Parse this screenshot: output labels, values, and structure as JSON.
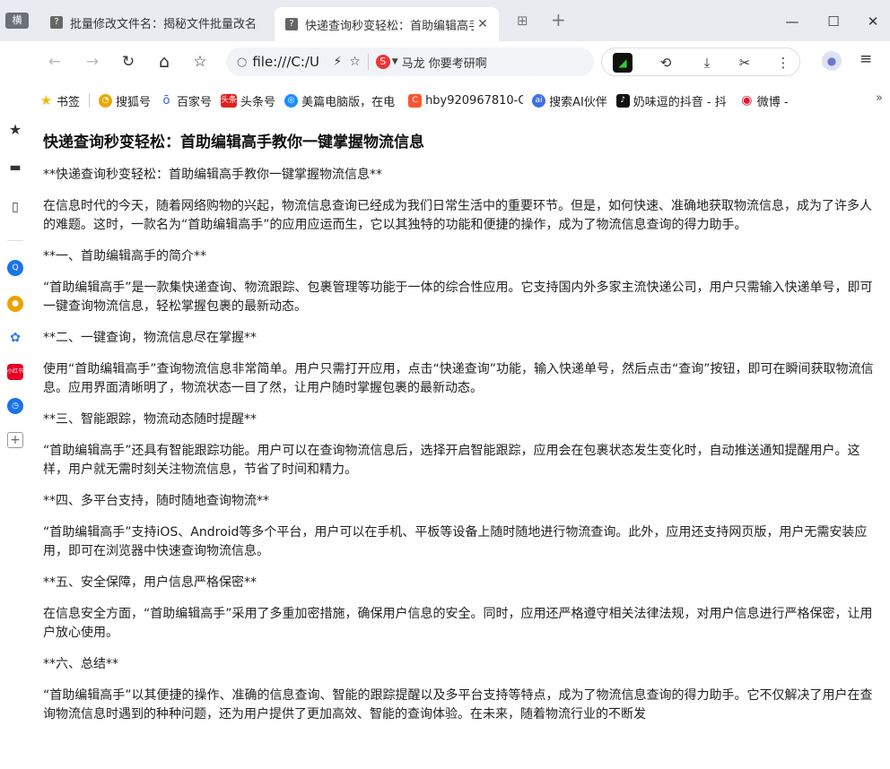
{
  "tabstrip": {
    "mode_label": "横",
    "tabs": [
      {
        "title": "批量修改文件名：揭秘文件批量改名",
        "active": false
      },
      {
        "title": "快递查询秒变轻松：首助编辑高手",
        "active": true
      }
    ],
    "close_glyph": "✕",
    "new_tab_glyph": "+",
    "window": {
      "minimize": "—",
      "maximize": "☐",
      "close": "✕"
    }
  },
  "toolbar": {
    "sidebar_toggle": "«",
    "back": "←",
    "forward": "→",
    "reload": "↻",
    "home": "⌂",
    "bookmark": "☆",
    "address": {
      "url": "file:///C:/U",
      "search_engine_letter": "S",
      "search_text": "马龙 你要考研啊"
    },
    "extensions": {
      "history": "⟲",
      "download": "⤓",
      "screenshot": "✂",
      "more": "⋮"
    },
    "menu": "≡"
  },
  "bookmarks": {
    "items": [
      {
        "label": "书签",
        "icon": "star-icon",
        "color": "#f5b800"
      },
      {
        "label": "搜狐号",
        "icon": "sohu-icon",
        "color": "#e8a800"
      },
      {
        "label": "百家号",
        "icon": "baijia-icon",
        "color": "#2b5ce6"
      },
      {
        "label": "头条号",
        "icon": "toutiao-icon",
        "color": "#e02020"
      },
      {
        "label": "美篇电脑版，在电",
        "icon": "meipian-icon",
        "color": "#1a8cff"
      },
      {
        "label": "hby920967810-C",
        "icon": "csdn-icon",
        "color": "#fc5531"
      },
      {
        "label": "搜索AI伙伴",
        "icon": "ai-icon",
        "color": "#3d6fe6"
      },
      {
        "label": "奶味逗的抖音 - 抖",
        "icon": "douyin-icon",
        "color": "#111111"
      },
      {
        "label": "微博 -",
        "icon": "weibo-icon",
        "color": "#e6162d"
      }
    ],
    "more": "»"
  },
  "sidebar": {
    "apps": [
      {
        "name": "favorites",
        "color": "#333333"
      },
      {
        "name": "folder",
        "color": "#333333"
      },
      {
        "name": "phone",
        "color": "#333333"
      },
      {
        "name": "search-app",
        "color": "#1a73e8"
      },
      {
        "name": "colorful-app",
        "color": "#f0a000"
      },
      {
        "name": "paw-app",
        "color": "#2e7be6"
      },
      {
        "name": "xiaohongshu-app",
        "color": "#e60023"
      },
      {
        "name": "clock-app",
        "color": "#1a73e8"
      },
      {
        "name": "add-app",
        "color": "#666666"
      }
    ]
  },
  "article": {
    "title": "快递查询秒变轻松：首助编辑高手教你一键掌握物流信息",
    "paragraphs": [
      "**快递查询秒变轻松：首助编辑高手教你一键掌握物流信息**",
      "在信息时代的今天，随着网络购物的兴起，物流信息查询已经成为我们日常生活中的重要环节。但是，如何快速、准确地获取物流信息，成为了许多人的难题。这时，一款名为“首助编辑高手”的应用应运而生，它以其独特的功能和便捷的操作，成为了物流信息查询的得力助手。",
      "**一、首助编辑高手的简介**",
      "“首助编辑高手”是一款集快递查询、物流跟踪、包裹管理等功能于一体的综合性应用。它支持国内外多家主流快递公司，用户只需输入快递单号，即可一键查询物流信息，轻松掌握包裹的最新动态。",
      "**二、一键查询，物流信息尽在掌握**",
      "使用“首助编辑高手”查询物流信息非常简单。用户只需打开应用，点击“快递查询”功能，输入快递单号，然后点击“查询”按钮，即可在瞬间获取物流信息。应用界面清晰明了，物流状态一目了然，让用户随时掌握包裹的最新动态。",
      "**三、智能跟踪，物流动态随时提醒**",
      "“首助编辑高手”还具有智能跟踪功能。用户可以在查询物流信息后，选择开启智能跟踪，应用会在包裹状态发生变化时，自动推送通知提醒用户。这样，用户就无需时刻关注物流信息，节省了时间和精力。",
      "**四、多平台支持，随时随地查询物流**",
      "“首助编辑高手”支持iOS、Android等多个平台，用户可以在手机、平板等设备上随时随地进行物流查询。此外，应用还支持网页版，用户无需安装应用，即可在浏览器中快速查询物流信息。",
      "**五、安全保障，用户信息严格保密**",
      "在信息安全方面，“首助编辑高手”采用了多重加密措施，确保用户信息的安全。同时，应用还严格遵守相关法律法规，对用户信息进行严格保密，让用户放心使用。",
      "**六、总结**",
      "“首助编辑高手”以其便捷的操作、准确的信息查询、智能的跟踪提醒以及多平台支持等特点，成为了物流信息查询的得力助手。它不仅解决了用户在查询物流信息时遇到的种种问题，还为用户提供了更加高效、智能的查询体验。在未来，随着物流行业的不断发"
    ]
  }
}
